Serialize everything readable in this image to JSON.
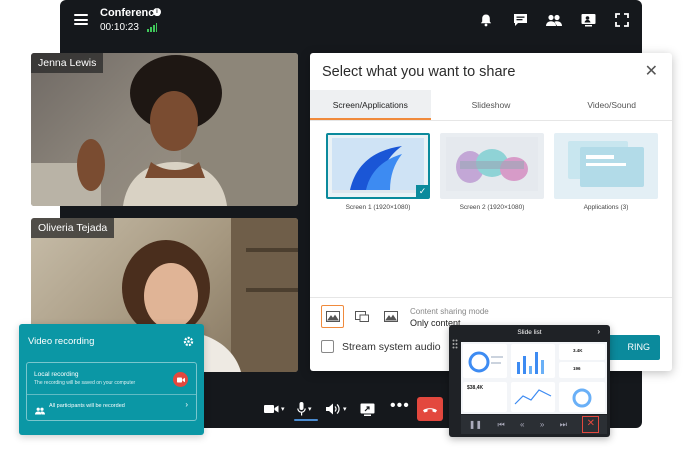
{
  "header": {
    "title": "Conference",
    "timer": "00:10:23"
  },
  "participants": [
    {
      "name": "Jenna Lewis"
    },
    {
      "name": "Oliveria Tejada"
    }
  ],
  "share_dialog": {
    "title": "Select what you want to share",
    "tabs": [
      {
        "label": "Screen/Applications"
      },
      {
        "label": "Slideshow"
      },
      {
        "label": "Video/Sound"
      }
    ],
    "options": [
      {
        "caption": "Screen 1 (1920×1080)"
      },
      {
        "caption": "Screen 2 (1920×1080)"
      },
      {
        "caption": "Applications (3)"
      }
    ],
    "mode_label": "Content sharing mode",
    "mode_value": "Only content",
    "stream_label": "Stream system audio",
    "start_button": "RING"
  },
  "recording": {
    "title": "Video recording",
    "local_label": "Local recording",
    "local_sub": "The recording will be saved on your computer",
    "all_label": "All participants will be recorded"
  },
  "slide_list": {
    "title": "Slide list",
    "preview_values": [
      "$38,4K",
      "3.4K",
      "196"
    ]
  },
  "colors": {
    "accent": "#0b8a9c",
    "tab_indicator": "#f08a3c",
    "hangup": "#e3483e",
    "window_bg": "#15181c"
  }
}
